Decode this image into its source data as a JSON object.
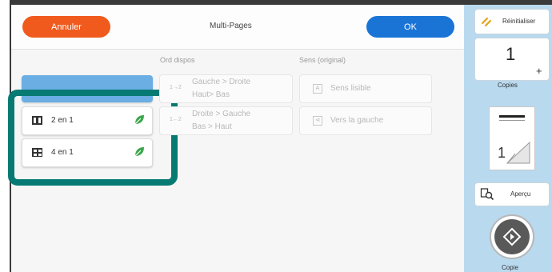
{
  "header": {
    "cancel_label": "Annuler",
    "title": "Multi-Pages",
    "ok_label": "OK"
  },
  "sections": {
    "layout_order_label": "Ord dispos",
    "orientation_label": "Sens (original)"
  },
  "multi_page_options": [
    {
      "label": "2 en 1",
      "icon": "two-up-icon",
      "eco": true
    },
    {
      "label": "4 en 1",
      "icon": "four-up-icon",
      "eco": true
    }
  ],
  "layout_order": [
    {
      "line1": "Gauche > Droite",
      "line2": "Haut> Bas",
      "glyph": "1→2"
    },
    {
      "line1": "Droite > Gauche",
      "line2": "Bas > Haut",
      "glyph": "1←2"
    }
  ],
  "orientation": [
    {
      "label": "Sens lisible",
      "glyph": "A"
    },
    {
      "label": "Vers la gauche",
      "glyph": "⊲"
    }
  ],
  "sidebar": {
    "reset_label": "Réinitialiser",
    "copies_value": "1",
    "copies_label": "Copies",
    "plus_symbol": "+",
    "preview_label": "Aperçu",
    "start_label": "Copie",
    "preview_page_number": "1"
  },
  "colors": {
    "cancel": "#f05a1d",
    "ok": "#1a74d6",
    "highlight": "#087a74",
    "selected": "#6aaee4",
    "eco_leaf": "#3aa64a",
    "sidebar": "#b9d9ee"
  }
}
